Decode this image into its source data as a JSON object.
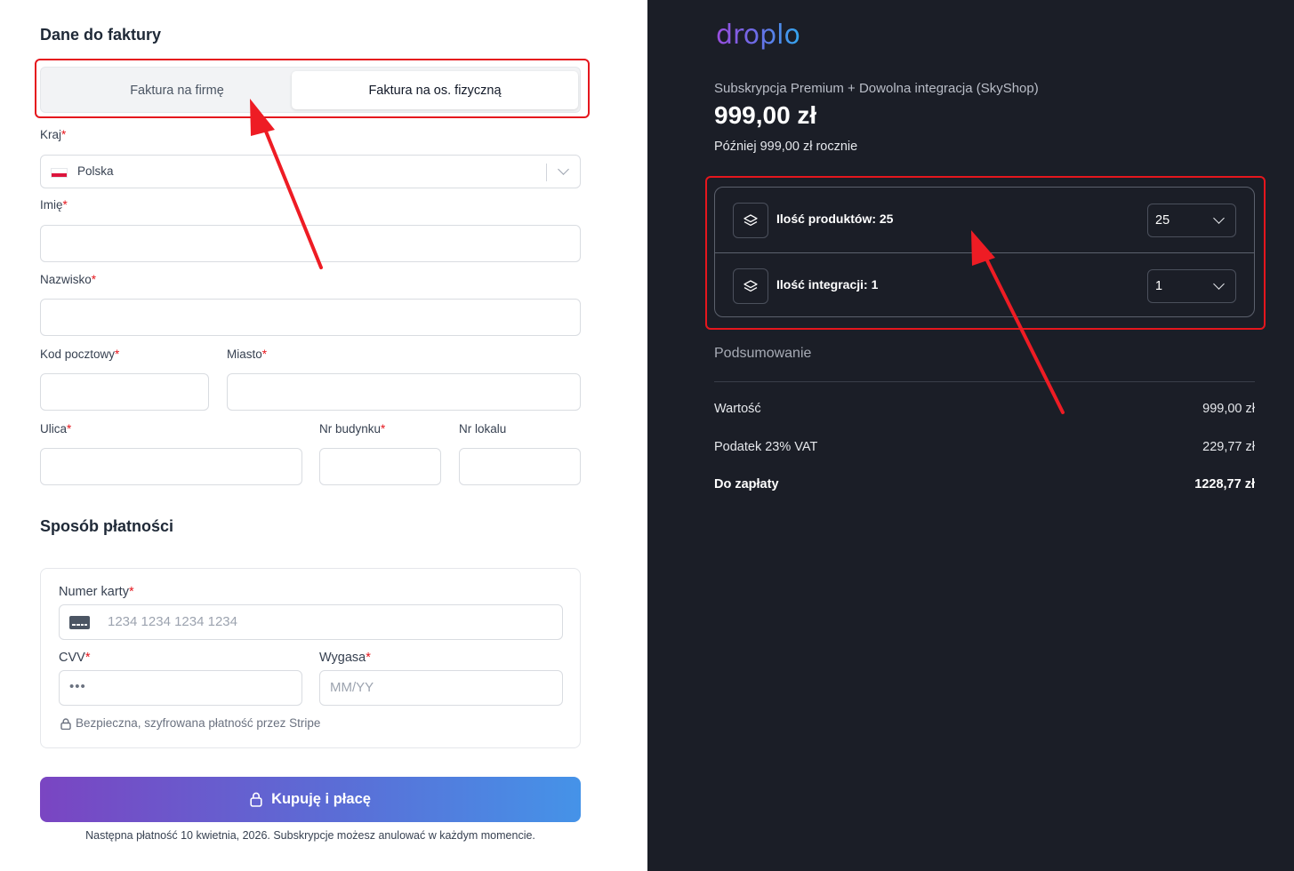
{
  "billing": {
    "title": "Dane do faktury",
    "tabs": [
      "Faktura na firmę",
      "Faktura na os. fizyczną"
    ],
    "country": {
      "label": "Kraj",
      "value": "Polska"
    },
    "first_name": {
      "label": "Imię"
    },
    "last_name": {
      "label": "Nazwisko"
    },
    "postal_code": {
      "label": "Kod pocztowy"
    },
    "city": {
      "label": "Miasto"
    },
    "street": {
      "label": "Ulica"
    },
    "building_no": {
      "label": "Nr budynku"
    },
    "unit_no": {
      "label": "Nr lokalu"
    },
    "required_mark": "*"
  },
  "payment": {
    "title": "Sposób płatności",
    "card_number": {
      "label": "Numer karty",
      "placeholder": "1234 1234 1234 1234"
    },
    "cvv": {
      "label": "CVV",
      "placeholder": "•••"
    },
    "expiry": {
      "label": "Wygasa",
      "placeholder": "MM/YY"
    },
    "secure_note": "Bezpieczna, szyfrowana płatność przez Stripe",
    "submit_label": "Kupuję i płacę",
    "footnote": "Następna płatność 10 kwietnia, 2026. Subskrypcje możesz anulować w każdym momencie."
  },
  "summary": {
    "logo": "droplo",
    "product_title": "Subskrypcja Premium + Dowolna integracja (SkyShop)",
    "price": "999,00 zł",
    "later": "Później 999,00 zł rocznie",
    "options": [
      {
        "label": "Ilość produktów: 25",
        "value": "25",
        "icon": "layers-icon"
      },
      {
        "label": "Ilość integracji: 1",
        "value": "1",
        "icon": "layers-icon"
      }
    ],
    "section_title": "Podsumowanie",
    "rows": [
      {
        "label": "Wartość",
        "value": "999,00 zł"
      },
      {
        "label": "Podatek 23% VAT",
        "value": "229,77 zł"
      },
      {
        "label": "Do zapłaty",
        "value": "1228,77 zł"
      }
    ]
  },
  "colors": {
    "annotation": "#e5161d",
    "dark_panel": "#1b1e27",
    "cta_gradient": [
      "#7a45c2",
      "#4593e8"
    ]
  }
}
